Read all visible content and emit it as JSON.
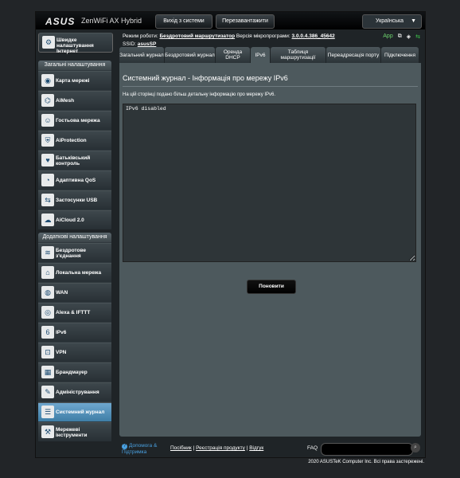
{
  "header": {
    "logo": "ASUS",
    "model": "ZenWiFi AX Hybrid",
    "logout_label": "Вихід з системи",
    "reboot_label": "Перезавантажити",
    "language": "Українська"
  },
  "sidebar": {
    "qis_label": "Швидке налаштування Інтернет",
    "general_title": "Загальні налаштування",
    "general_items": [
      {
        "label": "Карта мережі",
        "icon": "network-map-icon"
      },
      {
        "label": "AiMesh",
        "icon": "aimesh-icon"
      },
      {
        "label": "Гостьова мережа",
        "icon": "guest-network-icon"
      },
      {
        "label": "AiProtection",
        "icon": "aiprotection-icon"
      },
      {
        "label": "Батьківський контроль",
        "icon": "parental-control-icon"
      },
      {
        "label": "Адаптивна QoS",
        "icon": "qos-icon"
      },
      {
        "label": "Застосунки USB",
        "icon": "usb-icon"
      },
      {
        "label": "AiCloud 2.0",
        "icon": "cloud-icon"
      }
    ],
    "advanced_title": "Додаткові налаштування",
    "advanced_items": [
      {
        "label": "Бездротове з'єднання",
        "icon": "wireless-icon"
      },
      {
        "label": "Локальна мережа",
        "icon": "lan-icon"
      },
      {
        "label": "WAN",
        "icon": "wan-icon"
      },
      {
        "label": "Alexa & IFTTT",
        "icon": "alexa-icon"
      },
      {
        "label": "IPv6",
        "icon": "ipv6-icon"
      },
      {
        "label": "VPN",
        "icon": "vpn-icon"
      },
      {
        "label": "Брандмауер",
        "icon": "firewall-icon"
      },
      {
        "label": "Адміністрування",
        "icon": "administration-icon"
      },
      {
        "label": "Системний журнал",
        "icon": "system-log-icon"
      },
      {
        "label": "Мережеві інструменти",
        "icon": "network-tools-icon"
      }
    ]
  },
  "status": {
    "mode_label": "Режим роботи:",
    "mode_value": "Бездротовий маршрутизатор",
    "firmware_label": "Версія мікропрограми:",
    "firmware_value": "3.0.0.4.386_45642",
    "ssid_label": "SSID:",
    "ssid_value": "asusSP",
    "app_label": "App"
  },
  "tabs": [
    "Загальний журнал",
    "Бездротовий журнал",
    "Оренда DHCP",
    "IPv6",
    "Таблиця маршрутизації",
    "Переадресація порту",
    "Підключення"
  ],
  "main": {
    "title": "Системний журнал - Інформація про мережу IPv6",
    "description": "На цій сторінці подано більш детальну інформацію про мережу IPv6.",
    "log_text": "IPv6 disabled",
    "refresh_label": "Поновити"
  },
  "footer": {
    "help_label": "Допомога & Підтримка",
    "manual_link": "Посібник",
    "register_link": "Реєстрація продукту",
    "feedback_link": "Відгук",
    "faq_label": "FAQ",
    "copyright": "2020 ASUSTeK Computer Inc. Всі права застережені."
  }
}
